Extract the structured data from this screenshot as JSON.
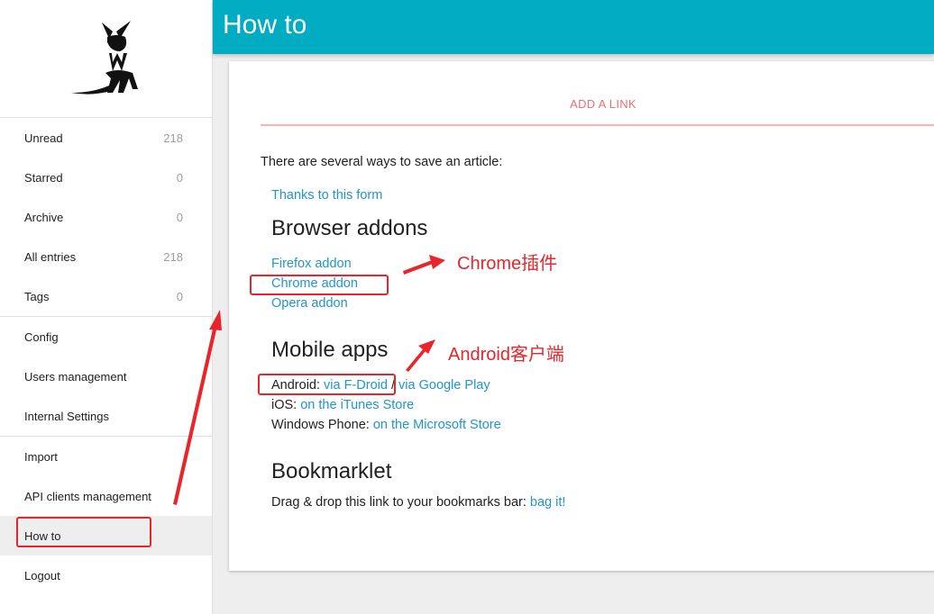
{
  "header": {
    "title": "How to"
  },
  "sidebar": {
    "logo": "wallabag-logo",
    "group1": [
      {
        "label": "Unread",
        "count": "218"
      },
      {
        "label": "Starred",
        "count": "0"
      },
      {
        "label": "Archive",
        "count": "0"
      },
      {
        "label": "All entries",
        "count": "218"
      },
      {
        "label": "Tags",
        "count": "0"
      }
    ],
    "group2": [
      {
        "label": "Config"
      },
      {
        "label": "Users management"
      },
      {
        "label": "Internal Settings"
      }
    ],
    "group3": [
      {
        "label": "Import"
      },
      {
        "label": "API clients management"
      },
      {
        "label": "How to"
      },
      {
        "label": "Logout"
      }
    ]
  },
  "main": {
    "tab_label": "ADD A LINK",
    "intro": "There are several ways to save an article:",
    "form_link": "Thanks to this form",
    "browser": {
      "heading": "Browser addons",
      "firefox": "Firefox addon",
      "chrome": "Chrome addon",
      "opera": "Opera addon"
    },
    "mobile": {
      "heading": "Mobile apps",
      "android_label": "Android:",
      "android_fdroid": "via F-Droid",
      "separator": "/",
      "android_play": "via Google Play",
      "ios_label": "iOS:",
      "ios_link": "on the iTunes Store",
      "wp_label": "Windows Phone:",
      "wp_link": "on the Microsoft Store"
    },
    "bookmarklet": {
      "heading": "Bookmarklet",
      "text": "Drag & drop this link to your bookmarks bar:",
      "link": "bag it!"
    }
  },
  "annotations": {
    "chrome": "Chrome插件",
    "android": "Android客户端"
  },
  "colors": {
    "header": "#00acc1",
    "accent_tab": "#ee6e73",
    "link": "#2196c8",
    "annotation": "#e8252a"
  }
}
